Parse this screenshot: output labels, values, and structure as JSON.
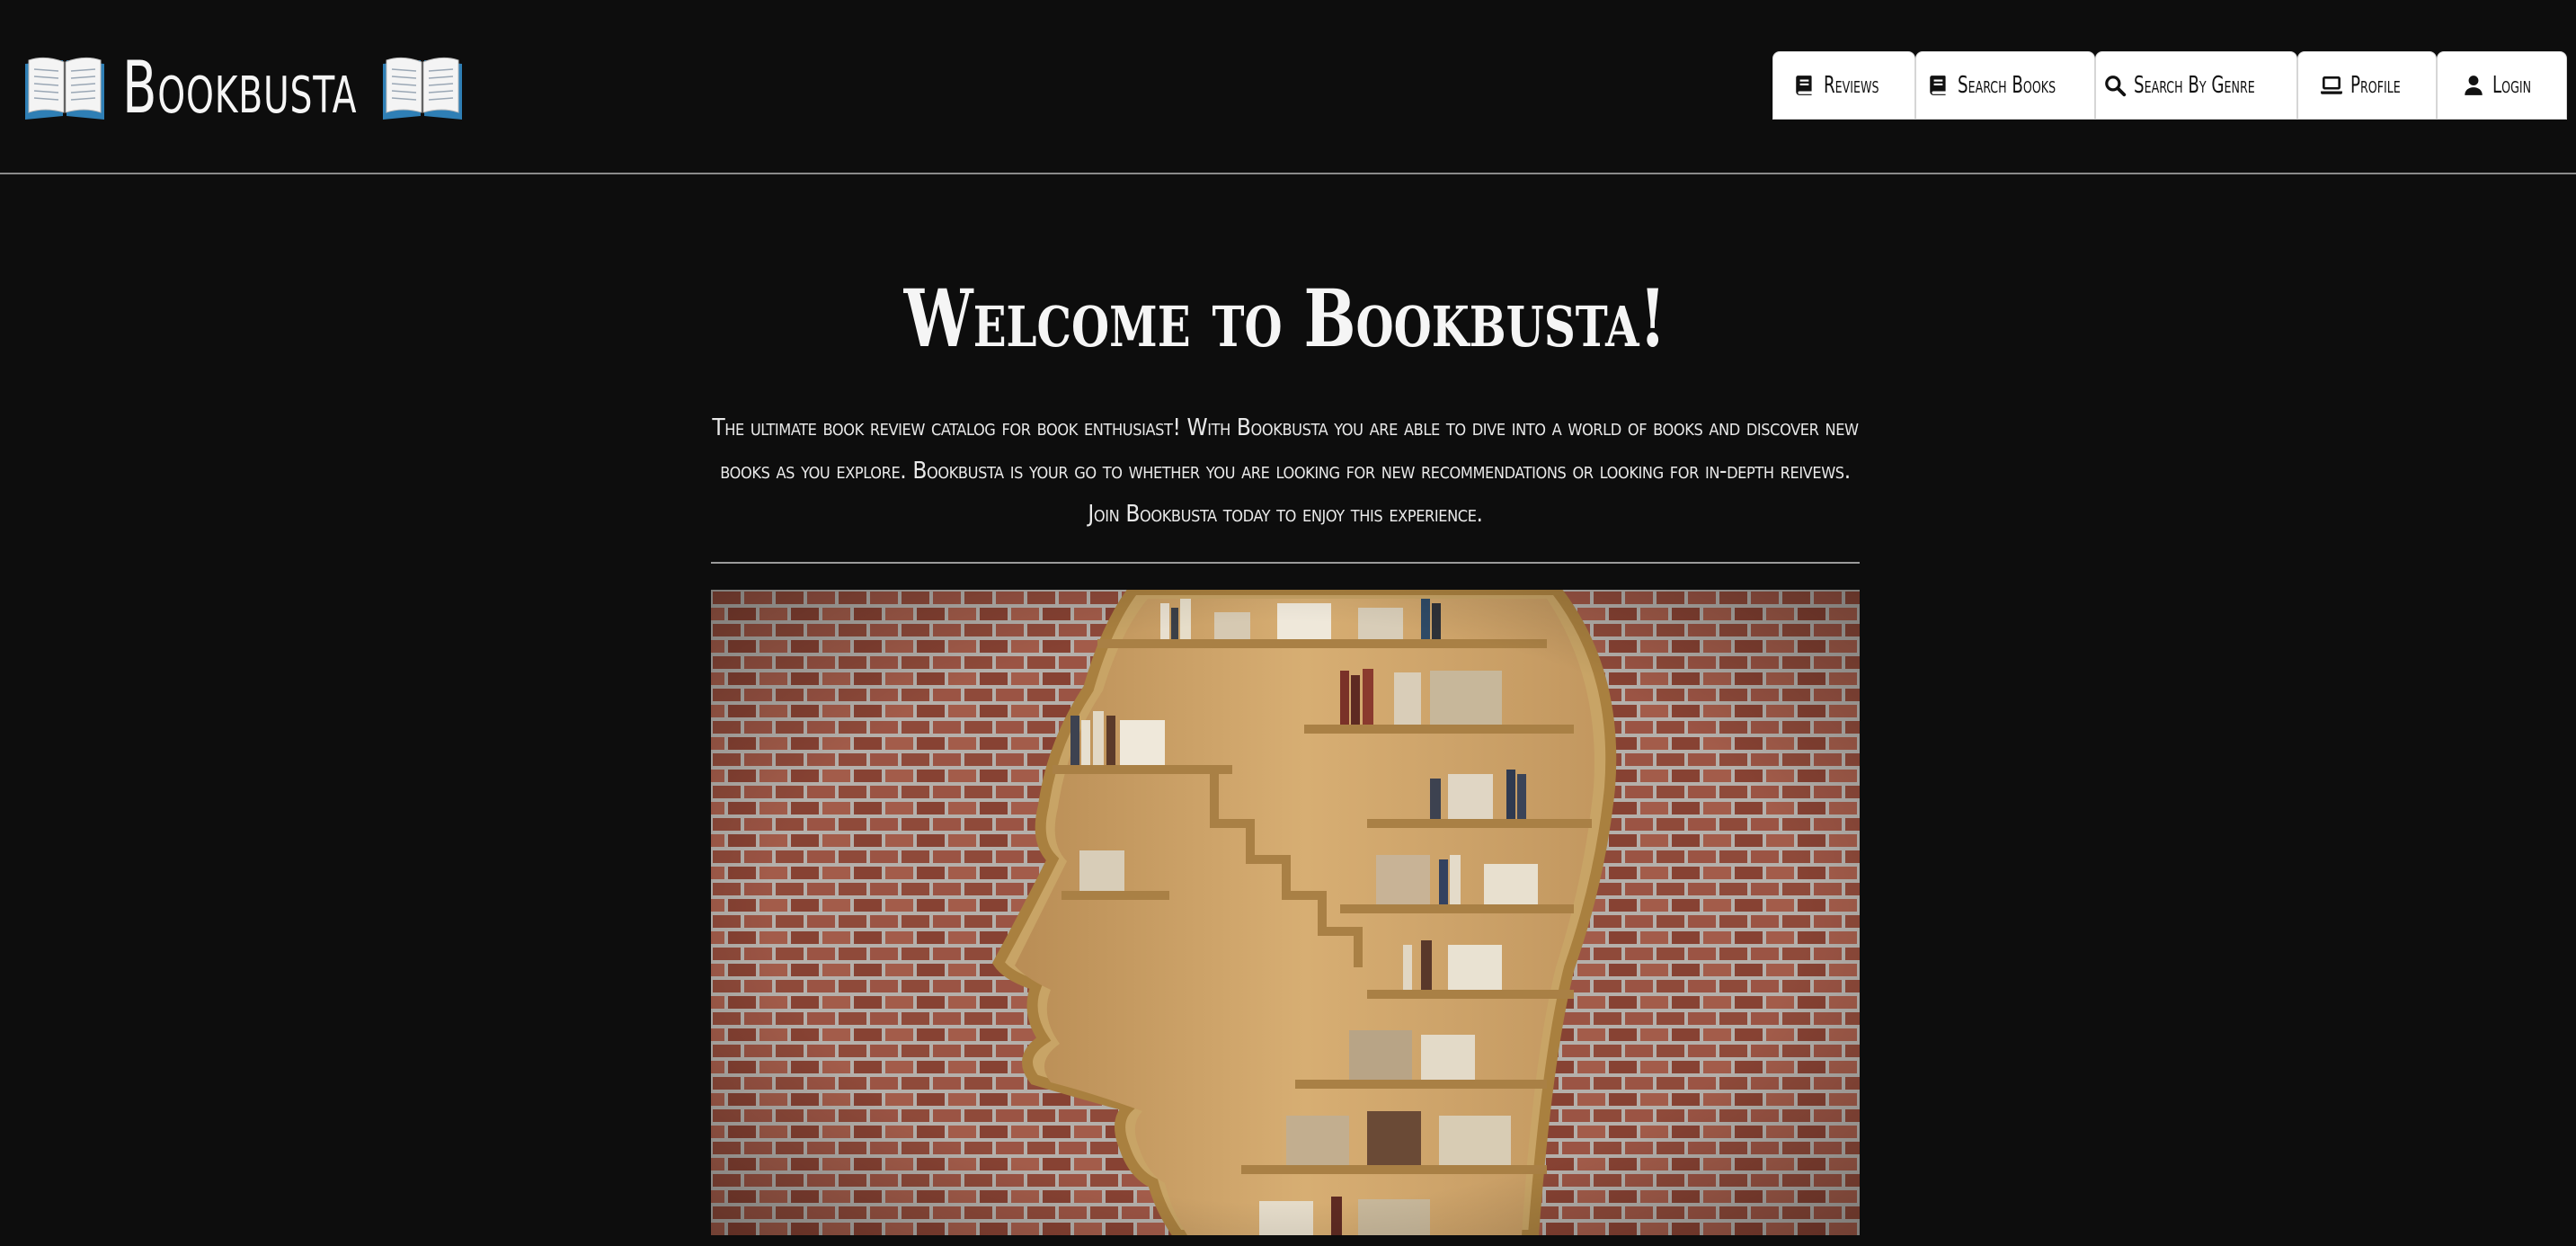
{
  "header": {
    "brand_title": "Bookbusta",
    "brand_icon_left": "open-book-icon",
    "brand_icon_right": "open-book-icon"
  },
  "nav": {
    "items": [
      {
        "label": "Reviews",
        "icon": "book-icon"
      },
      {
        "label": "Search Books",
        "icon": "book-icon"
      },
      {
        "label": "Search By Genre",
        "icon": "magnifier-icon"
      },
      {
        "label": "Profile",
        "icon": "laptop-icon"
      },
      {
        "label": "Login",
        "icon": "user-icon"
      }
    ]
  },
  "main": {
    "title": "Welcome to Bookbusta!",
    "intro": "The ultimate book review catalog for book enthusiast! With Bookbusta you are able to dive into a world of books and discover new books as you explore. Bookbusta is your go to whether you are looking for new recommendations or looking for in-depth reivews. Join Bookbusta today to enjoy this experience."
  },
  "colors": {
    "background": "#0d0d0d",
    "text": "#f2f2f2",
    "nav_background": "#ffffff",
    "divider": "#9a9a9a"
  }
}
